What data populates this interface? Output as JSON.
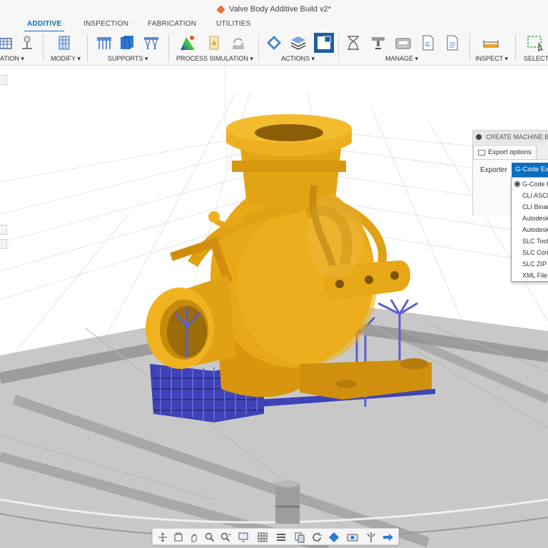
{
  "window": {
    "title": "Valve Body Additive Build v2*"
  },
  "tabs": [
    {
      "label": "ADDITIVE",
      "active": true
    },
    {
      "label": "INSPECTION",
      "active": false
    },
    {
      "label": "FABRICATION",
      "active": false
    },
    {
      "label": "UTILITIES",
      "active": false
    }
  ],
  "ribbon": {
    "groups": [
      {
        "label": "ATION ▾",
        "icons": [
          "machine-setup-icon",
          "position-icon"
        ]
      },
      {
        "label": "MODIFY ▾",
        "icons": [
          "modify-component-icon"
        ]
      },
      {
        "label": "SUPPORTS ▾",
        "icons": [
          "bar-support-icon",
          "volume-support-icon",
          "lattice-support-icon"
        ]
      },
      {
        "label": "PROCESS SIMULATION ▾",
        "icons": [
          "thermal-simulation-icon",
          "simulation-warning-icon",
          "simulation-compare-icon"
        ]
      },
      {
        "label": "ACTIONS ▾",
        "icons": [
          "generate-toolpath-icon",
          "simulate-layers-icon",
          "post-process-icon"
        ]
      },
      {
        "label": "MANAGE ▾",
        "icons": [
          "task-manager-icon",
          "machine-library-icon",
          "tool-library-icon",
          "post-library-icon",
          "template-library-icon"
        ]
      },
      {
        "label": "INSPECT ▾",
        "icons": [
          "measure-icon"
        ]
      },
      {
        "label": "SELECT",
        "icons": [
          "window-select-icon"
        ]
      }
    ]
  },
  "panel": {
    "title": "CREATE MACHINE B",
    "tab_label": "Export options",
    "exporter_label": "Exporter",
    "exporter_value": "G-Code Exp"
  },
  "exporter_options": [
    {
      "label": "G-Code E",
      "selected": true
    },
    {
      "label": "CLI ASCII",
      "selected": false
    },
    {
      "label": "CLI Binar",
      "selected": false
    },
    {
      "label": "Autodesk",
      "selected": false
    },
    {
      "label": "Autodesk",
      "selected": false
    },
    {
      "label": "SLC Tool",
      "selected": false
    },
    {
      "label": "SLC Con",
      "selected": false
    },
    {
      "label": "SLC ZIP",
      "selected": false
    },
    {
      "label": "XML File",
      "selected": false
    }
  ],
  "navbar": {
    "icons": [
      "orbit-icon",
      "look-at-icon",
      "pan-icon",
      "zoom-icon",
      "zoom-window-icon",
      "display-settings-icon",
      "grid-settings-icon",
      "layer-view-icon",
      "section-icon",
      "refresh-icon",
      "appearance-icon",
      "camera-icon",
      "effects-icon",
      "next-view-icon"
    ]
  },
  "colors": {
    "accent": "#0a6fc2",
    "part": "#e6a817",
    "supports": "#4a4fc4",
    "plate": "#b8b8b8"
  }
}
